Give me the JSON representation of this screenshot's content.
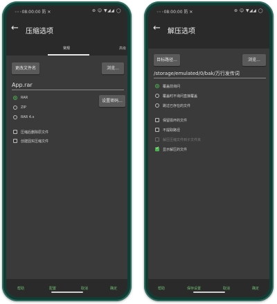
{
  "left": {
    "status": {
      "time": "◦◦◦08:00:00 防 ✕",
      "icons": "⊛ ☺ ▼◢◢ ◯"
    },
    "appbar": {
      "back": "←",
      "title": "压缩选项"
    },
    "tabs": {
      "active": "常规",
      "right_partial": "高级"
    },
    "buttons": {
      "name_btn": "更改文件名",
      "browse_btn": "浏览...",
      "set_pwd_btn": "设置密码..."
    },
    "filename": "App.rar",
    "radios": [
      {
        "label": "RAR",
        "checked": true
      },
      {
        "label": "ZIP",
        "checked": false
      },
      {
        "label": "RAR 4.x",
        "checked": false
      }
    ],
    "checks": [
      {
        "label": "压缩后删除原文件",
        "checked": false
      },
      {
        "label": "创建固实压缩文件",
        "checked": false
      }
    ],
    "footer": [
      "帮助",
      "配置",
      "取消",
      "确定"
    ]
  },
  "right": {
    "status": {
      "time": "◦◦◦08:00:00 防 ✕",
      "icons": "⊛ ☺ ▼◢◢ ◯"
    },
    "appbar": {
      "back": "←",
      "title": "解压选项"
    },
    "buttons": {
      "path_btn": "目标路径...",
      "browse_btn": "浏览..."
    },
    "path": "/storage/emulated/0/bak/万行发传词",
    "radios": [
      {
        "label": "覆盖前询问",
        "checked": true
      },
      {
        "label": "覆盖时不询问直接覆盖",
        "checked": false
      },
      {
        "label": "跳过已存在的文件",
        "checked": false
      }
    ],
    "checks": [
      {
        "label": "保留损坏的文件",
        "checked": false,
        "disabled": false
      },
      {
        "label": "不提取路径",
        "checked": false,
        "disabled": false
      },
      {
        "label": "解压压缩文件到子文件夹",
        "checked": false,
        "disabled": true
      },
      {
        "label": "显示解压的文件",
        "checked": true,
        "disabled": false
      }
    ],
    "footer": [
      "帮助",
      "保存设置",
      "取消",
      "确定"
    ]
  },
  "colors": {
    "accent": "#4caf50",
    "frame": "#123b34",
    "surface": "#3a3a3a",
    "bar": "#2a2a2a"
  }
}
